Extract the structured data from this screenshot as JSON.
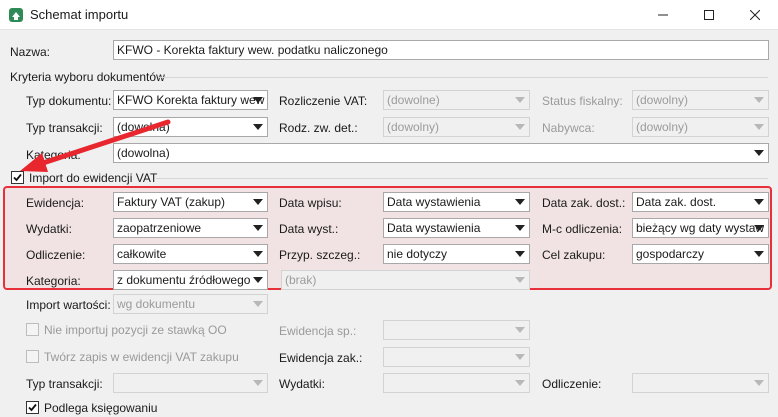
{
  "window": {
    "title": "Schemat importu",
    "controls": {
      "minimize": "minimize-icon",
      "maximize": "maximize-icon",
      "close": "close-icon"
    }
  },
  "nazwa": {
    "label": "Nazwa:",
    "value": "KFWO - Korekta faktury wew. podatku naliczonego"
  },
  "kryteria": {
    "section_label": "Kryteria wyboru dokumentów",
    "typ_dokumentu": {
      "label": "Typ dokumentu:",
      "value": "KFWO Korekta faktury wew"
    },
    "rozliczenie_vat": {
      "label": "Rozliczenie VAT:",
      "value": "(dowolne)"
    },
    "status_fiskalny": {
      "label": "Status fiskalny:",
      "value": "(dowolny)"
    },
    "typ_transakcji": {
      "label": "Typ transakcji:",
      "value": "(dowolna)"
    },
    "rodz_zw_det": {
      "label": "Rodz. zw. det.:",
      "value": "(dowolny)"
    },
    "nabywca": {
      "label": "Nabywca:",
      "value": "(dowolny)"
    },
    "kategoria": {
      "label": "Kategoria:",
      "value": "(dowolna)"
    }
  },
  "import_vat": {
    "label": "Import do ewidencji VAT",
    "checked": true,
    "ewidencja": {
      "label": "Ewidencja:",
      "value": "Faktury VAT (zakup)"
    },
    "data_wpisu": {
      "label": "Data wpisu:",
      "value": "Data wystawienia"
    },
    "data_zak_dost": {
      "label": "Data zak. dost.:",
      "value": "Data zak. dost."
    },
    "wydatki": {
      "label": "Wydatki:",
      "value": "zaopatrzeniowe"
    },
    "data_wyst": {
      "label": "Data wyst.:",
      "value": "Data wystawienia"
    },
    "mc_odliczenia": {
      "label": "M-c odliczenia:",
      "value": "bieżący wg daty wystaw"
    },
    "odliczenie": {
      "label": "Odliczenie:",
      "value": "całkowite"
    },
    "przyp_szczeg": {
      "label": "Przyp. szczeg.:",
      "value": "nie dotyczy"
    },
    "cel_zakupu": {
      "label": "Cel zakupu:",
      "value": "gospodarczy"
    },
    "kategoria": {
      "label": "Kategoria:",
      "value": "z dokumentu źródłowego"
    },
    "kategoria2": {
      "value": "(brak)"
    }
  },
  "lower": {
    "import_wartosci": {
      "label": "Import wartości:",
      "value": "wg dokumentu"
    },
    "nie_importuj": {
      "label": "Nie importuj pozycji ze stawką OO",
      "checked": false
    },
    "ewidencja_sp": {
      "label": "Ewidencja sp.:",
      "value": ""
    },
    "tworz_zapis": {
      "label": "Twórz zapis w ewidencji VAT zakupu",
      "checked": false
    },
    "ewidencja_zak": {
      "label": "Ewidencja zak.:",
      "value": ""
    },
    "typ_transakcji": {
      "label": "Typ transakcji:",
      "value": ""
    },
    "wydatki": {
      "label": "Wydatki:",
      "value": ""
    },
    "odliczenie": {
      "label": "Odliczenie:",
      "value": ""
    },
    "podlega": {
      "label": "Podlega księgowaniu",
      "checked": true
    }
  },
  "colors": {
    "highlight": "#e8303a",
    "arrow": "#e8262e"
  }
}
